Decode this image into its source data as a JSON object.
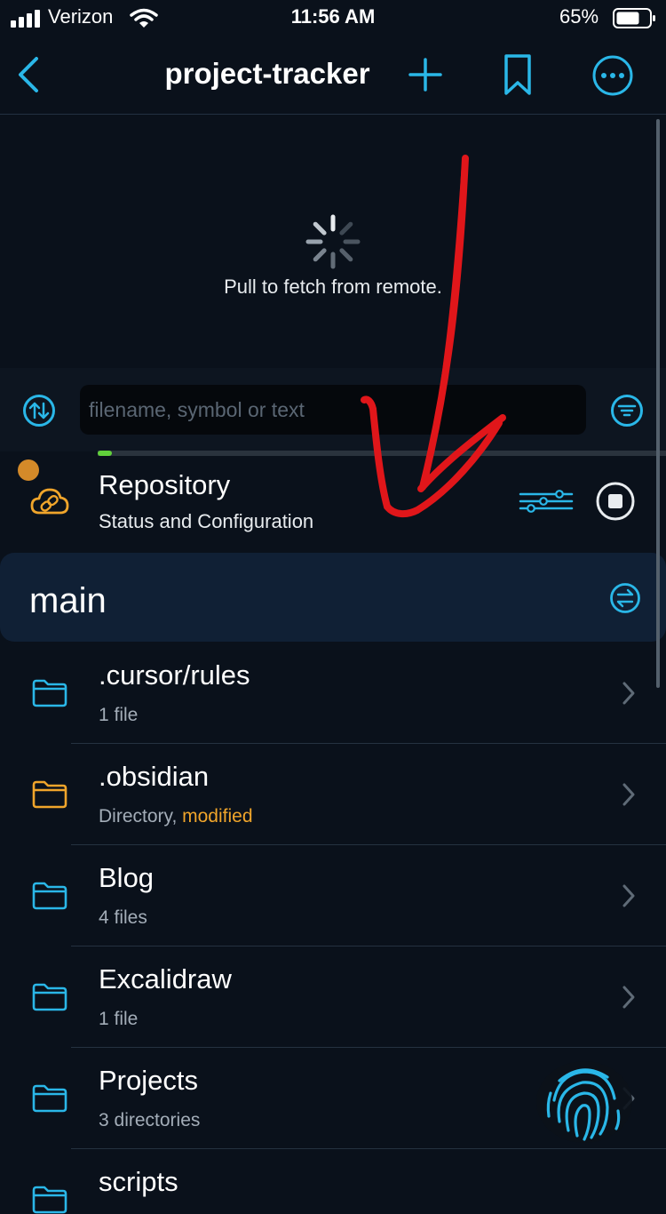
{
  "status_bar": {
    "carrier": "Verizon",
    "time": "11:56 AM",
    "battery": "65%"
  },
  "nav": {
    "title": "project-tracker",
    "icons": [
      "back-chevron-icon",
      "plus-icon",
      "bookmark-icon",
      "more-icon"
    ]
  },
  "pull": {
    "text": "Pull to fetch from remote."
  },
  "search": {
    "placeholder": "filename, symbol or text"
  },
  "progress": {
    "value_fraction": 0.025
  },
  "repository": {
    "title": "Repository",
    "subtitle": "Status and Configuration"
  },
  "branch": {
    "name": "main"
  },
  "files": [
    {
      "name": ".cursor/rules",
      "detail": "1 file",
      "modified": "",
      "color": "#2ab7e8"
    },
    {
      "name": ".obsidian",
      "detail": "Directory, ",
      "modified": "modified",
      "color": "#f0a52b"
    },
    {
      "name": "Blog",
      "detail": "4 files",
      "modified": "",
      "color": "#2ab7e8"
    },
    {
      "name": "Excalidraw",
      "detail": "1 file",
      "modified": "",
      "color": "#2ab7e8"
    },
    {
      "name": "Projects",
      "detail": "3 directories",
      "modified": "",
      "color": "#2ab7e8"
    },
    {
      "name": "scripts",
      "detail": "",
      "modified": "",
      "color": "#2ab7e8"
    }
  ],
  "colors": {
    "accent": "#2ab7e8",
    "modified": "#f0a52b",
    "annotation": "#e0161a",
    "progress": "#61d13b"
  }
}
